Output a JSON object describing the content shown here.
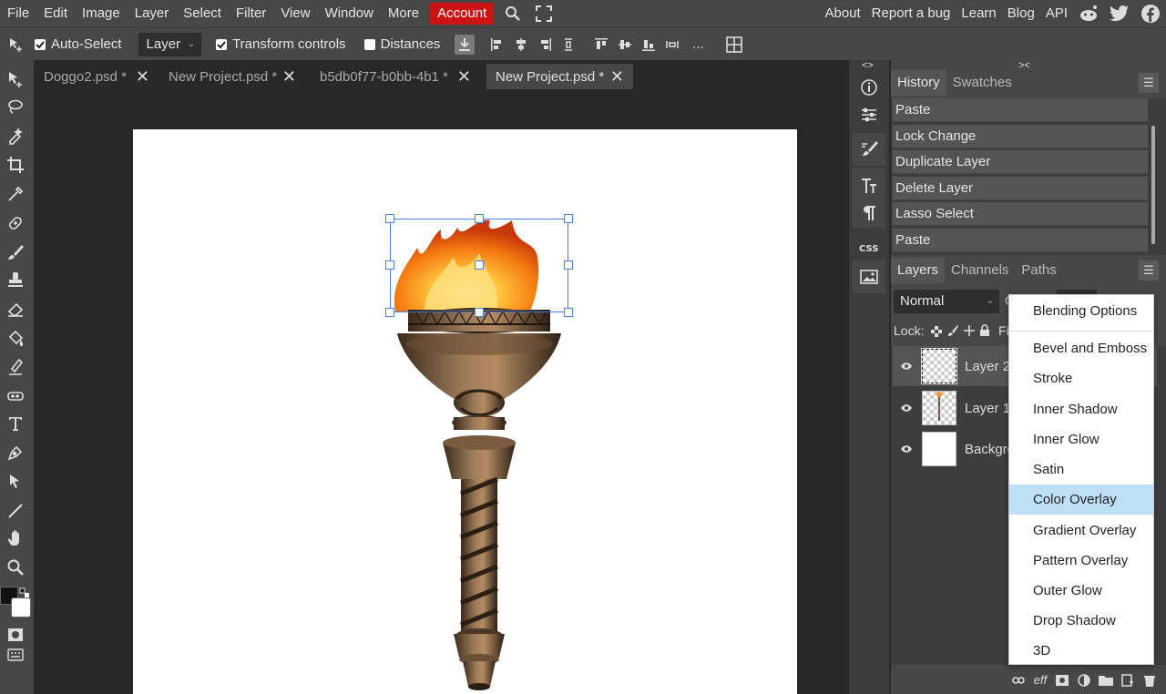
{
  "menubar": {
    "items": [
      "File",
      "Edit",
      "Image",
      "Layer",
      "Select",
      "Filter",
      "View",
      "Window",
      "More"
    ],
    "account": "Account",
    "right_links": [
      "About",
      "Report a bug",
      "Learn",
      "Blog",
      "API"
    ]
  },
  "options": {
    "auto_select": "Auto-Select",
    "layer_select": "Layer",
    "transform_controls": "Transform controls",
    "distances": "Distances",
    "more": "..."
  },
  "tabs": [
    {
      "label": "Doggo2.psd *"
    },
    {
      "label": "New Project.psd *"
    },
    {
      "label": "b5db0f77-b0bb-4b1 *"
    },
    {
      "label": "New Project.psd *"
    }
  ],
  "tab_close": "✕",
  "strip_arrows": {
    "left": "<>",
    "right": "><"
  },
  "history": {
    "tabs": [
      "History",
      "Swatches"
    ],
    "items": [
      "Paste",
      "Lock Change",
      "Duplicate Layer",
      "Delete Layer",
      "Lasso Select",
      "Paste"
    ]
  },
  "layers_panel": {
    "tabs": [
      "Layers",
      "Channels",
      "Paths"
    ],
    "blend_mode": "Normal",
    "opacity_prefix": "O",
    "lock_label": "Lock:",
    "fill_prefix": "Fi",
    "layers": [
      "Layer 2",
      "Layer 1",
      "Background"
    ]
  },
  "context_menu": {
    "items": [
      "Blending Options",
      "Bevel and Emboss",
      "Stroke",
      "Inner Shadow",
      "Inner Glow",
      "Satin",
      "Color Overlay",
      "Gradient Overlay",
      "Pattern Overlay",
      "Outer Glow",
      "Drop Shadow",
      "3D"
    ],
    "highlighted": "Color Overlay"
  },
  "bottom_bar": {
    "effects_label": "eff"
  },
  "colors": {
    "accent_red": "#cc1212",
    "menu_highlight": "#bde0f7",
    "selection_box": "#4a7fe0"
  }
}
